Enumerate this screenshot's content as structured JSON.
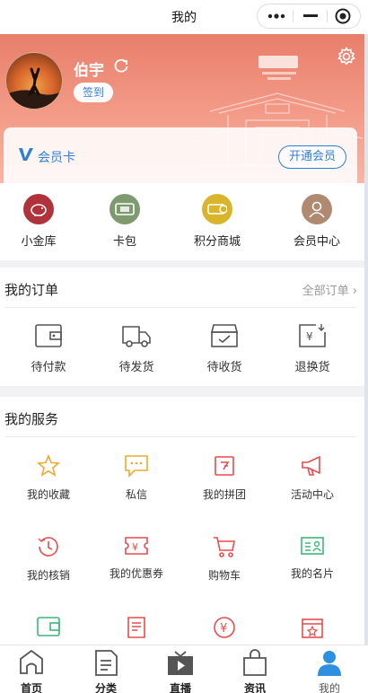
{
  "titlebar": {
    "title": "我的",
    "more_icon": "more-dots-icon",
    "minimize_icon": "minimize-icon",
    "close_icon": "target-close-icon"
  },
  "profile": {
    "username": "伯宇",
    "signin_label": "签到",
    "refresh_icon": "refresh-icon",
    "settings_icon": "gear-icon"
  },
  "vip": {
    "label": "会员卡",
    "open_label": "开通会员",
    "accent": "#2f7fd8"
  },
  "quick": [
    {
      "label": "小金库",
      "icon": "piggy-bank-icon",
      "color": "#b0333c"
    },
    {
      "label": "卡包",
      "icon": "card-wallet-icon",
      "color": "#7f9a6e"
    },
    {
      "label": "积分商城",
      "icon": "coins-icon",
      "color": "#d9b52b"
    },
    {
      "label": "会员中心",
      "icon": "member-icon",
      "color": "#b08a70"
    }
  ],
  "orders": {
    "title": "我的订单",
    "all_label": "全部订单",
    "items": [
      {
        "label": "待付款",
        "icon": "wallet-icon"
      },
      {
        "label": "待发货",
        "icon": "truck-icon"
      },
      {
        "label": "待收货",
        "icon": "box-check-icon"
      },
      {
        "label": "退换货",
        "icon": "refund-icon"
      }
    ]
  },
  "services": {
    "title": "我的服务",
    "items": [
      {
        "label": "我的收藏",
        "icon": "star-icon",
        "color": "#f0a830"
      },
      {
        "label": "私信",
        "icon": "message-icon",
        "color": "#f0a830"
      },
      {
        "label": "我的拼团",
        "icon": "group-buy-icon",
        "color": "#e84c4c"
      },
      {
        "label": "活动中心",
        "icon": "megaphone-icon",
        "color": "#e84c4c"
      },
      {
        "label": "我的核销",
        "icon": "clock-icon",
        "color": "#e84c4c"
      },
      {
        "label": "我的优惠券",
        "icon": "coupon-icon",
        "color": "#e84c4c"
      },
      {
        "label": "购物车",
        "icon": "cart-icon",
        "color": "#e84c4c"
      },
      {
        "label": "我的名片",
        "icon": "business-card-icon",
        "color": "#3cb878"
      },
      {
        "label": "",
        "icon": "wallet-green-icon",
        "color": "#3cb878"
      },
      {
        "label": "",
        "icon": "bill-icon",
        "color": "#e84c4c"
      },
      {
        "label": "",
        "icon": "yen-circle-icon",
        "color": "#e84c4c"
      },
      {
        "label": "",
        "icon": "calendar-star-icon",
        "color": "#e84c4c"
      }
    ]
  },
  "tabs": [
    {
      "label": "首页",
      "icon": "home-icon"
    },
    {
      "label": "分类",
      "icon": "list-doc-icon"
    },
    {
      "label": "直播",
      "icon": "tv-play-icon"
    },
    {
      "label": "资讯",
      "icon": "bag-icon"
    },
    {
      "label": "我的",
      "icon": "person-icon",
      "active": true,
      "color": "#2f8fe0"
    }
  ]
}
